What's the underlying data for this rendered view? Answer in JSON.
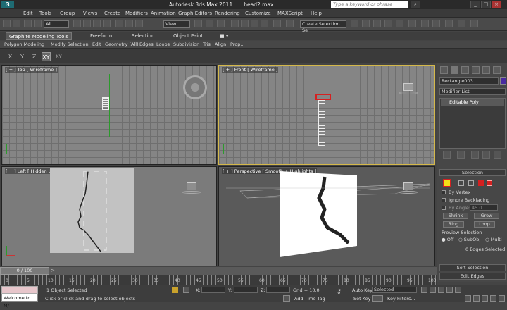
{
  "titlebar": {
    "app": "Autodesk 3ds Max  2011",
    "file": "head2.max",
    "search_placeholder": "Type a keyword or phrase"
  },
  "menu": [
    "Edit",
    "Tools",
    "Group",
    "Views",
    "Create",
    "Modifiers",
    "Animation",
    "Graph Editors",
    "Rendering",
    "Customize",
    "MAXScript",
    "Help"
  ],
  "toolbar": {
    "filter": "All",
    "ref_coord": "View",
    "selection_set": "Create Selection Se"
  },
  "ribbon": {
    "tabs": [
      "Graphite Modeling Tools",
      "Freeform",
      "Selection",
      "Object Paint"
    ],
    "panel": [
      "Polygon Modeling",
      "Modify Selection",
      "Edit",
      "Geometry (All)",
      "Edges",
      "Loops",
      "Subdivision",
      "Tris",
      "Align",
      "Prop..."
    ]
  },
  "axes": [
    "X",
    "Y",
    "Z",
    "XY",
    "XY"
  ],
  "viewports": {
    "top": "[ + ] Top [ Wireframe ]",
    "front": "[ + ] Front [ Wireframe ]",
    "left": "[ + ] Left [ Hidden Line ]",
    "persp": "[ + ] Perspective [ Smooth + Highlights ]"
  },
  "command_panel": {
    "object_name": "Rectangle003",
    "modifier_list": "Modifier List",
    "stack_item": "Editable Poly",
    "selection_title": "Selection",
    "by_vertex": "By Vertex",
    "ignore_backfacing": "Ignore Backfacing",
    "by_angle": "By Angle:",
    "by_angle_value": "45.0",
    "shrink": "Shrink",
    "grow": "Grow",
    "ring": "Ring",
    "loop": "Loop",
    "preview_title": "Preview Selection",
    "preview_off": "Off",
    "preview_subobj": "SubObj",
    "preview_multi": "Multi",
    "edges_selected": "0 Edges Selected",
    "soft_selection": "Soft Selection",
    "edit_edges": "Edit Edges"
  },
  "timeline": {
    "frame": "0 / 100",
    "ticks": [
      "0",
      "5",
      "10",
      "15",
      "20",
      "25",
      "30",
      "35",
      "40",
      "45",
      "50",
      "55",
      "60",
      "65",
      "70",
      "75",
      "80",
      "85",
      "90",
      "95",
      "100"
    ]
  },
  "status": {
    "objects": "1 Object Selected",
    "prompt": "Click or click-and-drag to select objects",
    "x_label": "X:",
    "y_label": "Y:",
    "z_label": "Z:",
    "grid": "Grid = 10.0",
    "add_time_tag": "Add Time Tag",
    "auto_key": "Auto Key",
    "set_key": "Set Key",
    "selected": "Selected",
    "key_filters": "Key Filters...",
    "welcome": "Welcome to M/"
  }
}
